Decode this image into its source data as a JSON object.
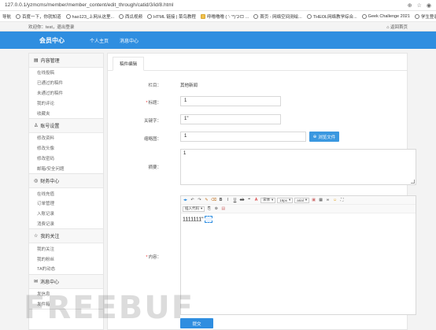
{
  "browser": {
    "url": "127.0.0.1/yzmcms/member/member_content/edit_through/catid/3/id/8.html",
    "bookmarks": [
      {
        "label": "导航",
        "icon": "none"
      },
      {
        "label": "百度一下，你就知道",
        "icon": "globe"
      },
      {
        "label": "hao123_上网从这里...",
        "icon": "globe"
      },
      {
        "label": "西瓜视频",
        "icon": "globe"
      },
      {
        "label": "HTML 链接 | 菜鸟教程",
        "icon": "globe"
      },
      {
        "label": "呼噜噜噜 ( '- '*)つロ ...",
        "icon": "folder"
      },
      {
        "label": "首页 - 网络空间测绘...",
        "icon": "globe"
      },
      {
        "label": "THEOL网络教学综合...",
        "icon": "globe"
      },
      {
        "label": "Geek Challenge 2021",
        "icon": "globe"
      },
      {
        "label": "学生登录",
        "icon": "globe"
      }
    ]
  },
  "topstrip": {
    "welcome": "欢迎你：test，退出登录",
    "home": "返回首页"
  },
  "header": {
    "brand": "会员中心",
    "nav": [
      "个人主页",
      "消息中心"
    ]
  },
  "sidebar": {
    "sections": [
      {
        "title": "内容管理",
        "icon": "document-icon",
        "items": [
          "在线投稿",
          "已通过的稿件",
          "未通过的稿件",
          "我的评论",
          "收藏夹"
        ]
      },
      {
        "title": "账号设置",
        "icon": "user-icon",
        "items": [
          "修改资料",
          "修改头像",
          "修改密码",
          "邮箱/安全问题"
        ]
      },
      {
        "title": "财务中心",
        "icon": "wallet-icon",
        "items": [
          "在线充值",
          "订单管理",
          "入账记录",
          "消费记录"
        ]
      },
      {
        "title": "我的关注",
        "icon": "star-icon",
        "items": [
          "我的关注",
          "我的粉丝",
          "TA的动态"
        ]
      },
      {
        "title": "消息中心",
        "icon": "message-icon",
        "items": [
          "发信息",
          "发件箱"
        ]
      }
    ]
  },
  "main": {
    "tab": "稿件编辑",
    "column_label": "栏目：",
    "column_value": "其他新闻",
    "title_label": "标题：",
    "title_value": "1",
    "keywords_label": "关键字：",
    "keywords_value": "1\"",
    "thumb_label": "缩略图：",
    "thumb_value": "1",
    "browse_button": "浏览文件",
    "desc_label": "摘要：",
    "desc_value": "1",
    "content_label": "内容：",
    "editor_toolbar": {
      "font_family": "宋体",
      "font_size": "16px",
      "style": "arial",
      "insert_code": "插入代码"
    },
    "editor_content": "1111111\"",
    "submit": "提交"
  },
  "watermark": "FREEBUF",
  "colors": {
    "primary": "#2f8ee0",
    "required": "#e33333"
  }
}
